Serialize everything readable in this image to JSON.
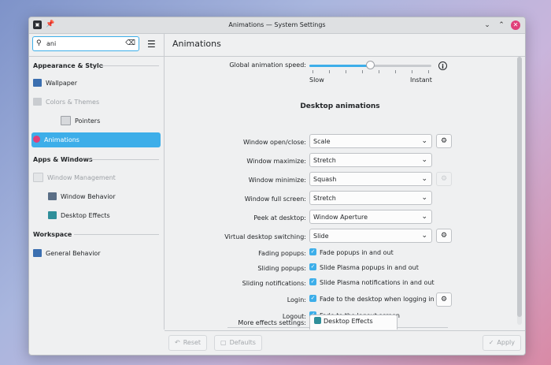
{
  "window": {
    "title": "Animations — System Settings"
  },
  "search": {
    "value": "ani"
  },
  "sidebar": {
    "sections": [
      {
        "label": "Appearance & Style"
      },
      {
        "label": "Apps & Windows"
      },
      {
        "label": "Workspace"
      }
    ],
    "items": [
      {
        "label": "Wallpaper"
      },
      {
        "label": "Colors & Themes"
      },
      {
        "label": "Pointers"
      },
      {
        "label": "Animations"
      },
      {
        "label": "Window Management"
      },
      {
        "label": "Window Behavior"
      },
      {
        "label": "Desktop Effects"
      },
      {
        "label": "General Behavior"
      }
    ]
  },
  "page": {
    "title": "Animations",
    "speed": {
      "label": "Global animation speed:",
      "slow": "Slow",
      "instant": "Instant",
      "value_fraction": 0.5
    },
    "section_title": "Desktop animations",
    "rows": [
      {
        "label": "Window open/close:",
        "value": "Scale"
      },
      {
        "label": "Window maximize:",
        "value": "Stretch"
      },
      {
        "label": "Window minimize:",
        "value": "Squash"
      },
      {
        "label": "Window full screen:",
        "value": "Stretch"
      },
      {
        "label": "Peek at desktop:",
        "value": "Window Aperture"
      },
      {
        "label": "Virtual desktop switching:",
        "value": "Slide"
      }
    ],
    "checks": [
      {
        "label": "Fading popups:",
        "text": "Fade popups in and out",
        "checked": true
      },
      {
        "label": "Sliding popups:",
        "text": "Slide Plasma popups in and out",
        "checked": true
      },
      {
        "label": "Sliding notifications:",
        "text": "Slide Plasma notifications in and out",
        "checked": true
      },
      {
        "label": "Login:",
        "text": "Fade to the desktop when logging in",
        "checked": true
      },
      {
        "label": "Logout:",
        "text": "Fade to the logout screen",
        "checked": true
      }
    ],
    "more": {
      "label": "More effects settings:",
      "button": "Desktop Effects"
    }
  },
  "footer": {
    "reset": "Reset",
    "defaults": "Defaults",
    "apply": "Apply"
  },
  "colors": {
    "accent": "#3daee9",
    "close": "#e0407a"
  }
}
